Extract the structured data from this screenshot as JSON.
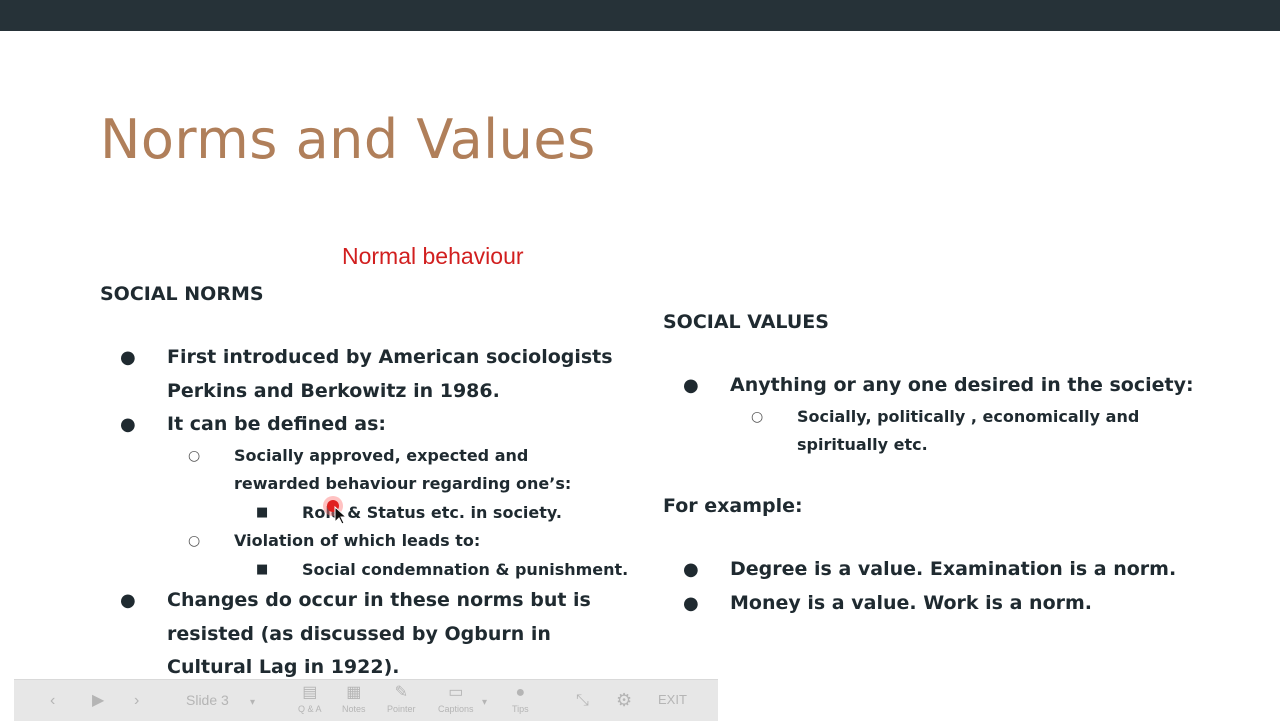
{
  "slide": {
    "title": "Norms and Values",
    "annotation": "Normal behaviour",
    "left": {
      "heading": "SOCIAL NORMS",
      "items": [
        "First introduced by American sociologists Perkins and Berkowitz in 1986.",
        "It can be defined as:",
        "Socially approved, expected and rewarded behaviour regarding one’s:",
        "Role & Status etc. in society.",
        "Violation of which leads to:",
        "Social condemnation & punishment.",
        "Changes do occur in these norms but is resisted (as discussed by Ogburn in Cultural Lag in 1922)."
      ]
    },
    "right": {
      "heading": "SOCIAL VALUES",
      "items": [
        "Anything or any one desired in the society:",
        "Socially, politically , economically and spiritually etc."
      ],
      "example_heading": "For example:",
      "examples": [
        "Degree is a value. Examination is a norm.",
        "Money is a value. Work is a norm."
      ]
    }
  },
  "controls": {
    "slide_label": "Slide 3",
    "qa": "Q & A",
    "notes": "Notes",
    "pointer": "Pointer",
    "captions": "Captions",
    "tips": "Tips",
    "exit": "EXIT"
  },
  "colors": {
    "title": "#b07f5a",
    "annotation": "#d11f1f",
    "text": "#1f2a30",
    "topbar": "#263238"
  }
}
